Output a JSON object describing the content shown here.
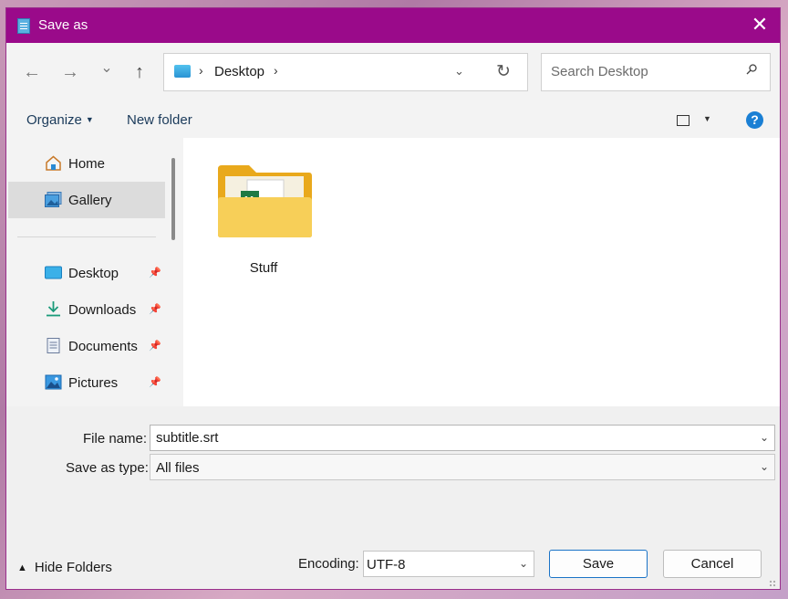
{
  "window": {
    "title": "Save as",
    "close_glyph": "✕"
  },
  "nav": {
    "back_glyph": "←",
    "forward_glyph": "→",
    "recent_glyph": "⌄",
    "up_glyph": "↑",
    "address": {
      "location": "Desktop",
      "separator": "›",
      "dropdown_glyph": "⌄",
      "refresh_glyph": "↻"
    },
    "search": {
      "placeholder": "Search Desktop",
      "value": ""
    }
  },
  "toolbar": {
    "organize_label": "Organize",
    "new_folder_label": "New folder",
    "help_glyph": "?"
  },
  "sidebar": {
    "items": [
      {
        "label": "Home",
        "icon": "home-icon",
        "selected": false,
        "pinned": false
      },
      {
        "label": "Gallery",
        "icon": "gallery-icon",
        "selected": true,
        "pinned": false
      },
      {
        "label": "Desktop",
        "icon": "desktop-icon",
        "selected": false,
        "pinned": true
      },
      {
        "label": "Downloads",
        "icon": "downloads-icon",
        "selected": false,
        "pinned": true
      },
      {
        "label": "Documents",
        "icon": "documents-icon",
        "selected": false,
        "pinned": true
      },
      {
        "label": "Pictures",
        "icon": "pictures-icon",
        "selected": false,
        "pinned": true
      }
    ]
  },
  "content": {
    "items": [
      {
        "label": "Stuff",
        "type": "folder"
      }
    ]
  },
  "form": {
    "file_name_label": "File name:",
    "file_name_value": "subtitle.srt",
    "save_type_label": "Save as type:",
    "save_type_value": "All files",
    "encoding_label": "Encoding:",
    "encoding_value": "UTF-8"
  },
  "footer": {
    "hide_folders_label": "Hide Folders",
    "save_label": "Save",
    "cancel_label": "Cancel"
  },
  "colors": {
    "title_bar": "#9a0a8a",
    "accent": "#1a73c7",
    "folder": "#f6c84a"
  }
}
